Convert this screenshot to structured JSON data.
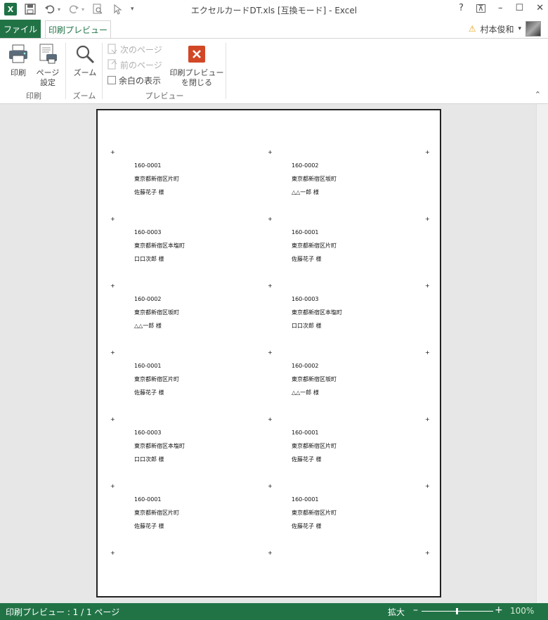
{
  "window": {
    "title": "エクセルカードDT.xls  [互換モード] - Excel",
    "help": "?",
    "ribbon_display": "⊼",
    "minimize": "–",
    "maximize": "☐",
    "close": "✕"
  },
  "qat": {
    "logo": "X",
    "undo_arrow": "▾",
    "redo_arrow": "▾",
    "more": "▾"
  },
  "tabs": {
    "file": "ファイル",
    "print_preview": "印刷プレビュー"
  },
  "user": {
    "warning": "⚠",
    "name": "村本俊和",
    "dropdown": "▾"
  },
  "ribbon": {
    "print_group": {
      "print_label": "印刷",
      "page_setup_label_1": "ページ",
      "page_setup_label_2": "設定",
      "group_label": "印刷"
    },
    "zoom_group": {
      "zoom_label": "ズーム",
      "group_label": "ズーム"
    },
    "preview_group": {
      "next_page": "次のページ",
      "prev_page": "前のページ",
      "show_margins": "余白の表示",
      "close_label_1": "印刷プレビュー",
      "close_label_2": "を閉じる",
      "group_label": "プレビュー"
    },
    "collapse": "⌃"
  },
  "labels": [
    {
      "zip": "160-0001",
      "address": "東京都新宿区片町",
      "name": "佐藤花子  様"
    },
    {
      "zip": "160-0002",
      "address": "東京都新宿区坂町",
      "name": "△△一郎  様"
    },
    {
      "zip": "160-0003",
      "address": "東京都新宿区本塩町",
      "name": "口口次郎  様"
    },
    {
      "zip": "160-0001",
      "address": "東京都新宿区片町",
      "name": "佐藤花子  様"
    },
    {
      "zip": "160-0002",
      "address": "東京都新宿区坂町",
      "name": "△△一郎  様"
    },
    {
      "zip": "160-0003",
      "address": "東京都新宿区本塩町",
      "name": "口口次郎  様"
    },
    {
      "zip": "160-0001",
      "address": "東京都新宿区片町",
      "name": "佐藤花子  様"
    },
    {
      "zip": "160-0002",
      "address": "東京都新宿区坂町",
      "name": "△△一郎  様"
    },
    {
      "zip": "160-0003",
      "address": "東京都新宿区本塩町",
      "name": "口口次郎  様"
    },
    {
      "zip": "160-0001",
      "address": "東京都新宿区片町",
      "name": "佐藤花子  様"
    },
    {
      "zip": "160-0001",
      "address": "東京都新宿区片町",
      "name": "佐藤花子  様"
    },
    {
      "zip": "160-0001",
      "address": "東京都新宿区片町",
      "name": "佐藤花子  様"
    }
  ],
  "crop_mark": "+",
  "status": {
    "page_info": "印刷プレビュー : 1 / 1 ページ",
    "zoom_word": "拡大",
    "zoom_minus": "–",
    "zoom_plus": "+",
    "zoom_percent": "100%"
  }
}
